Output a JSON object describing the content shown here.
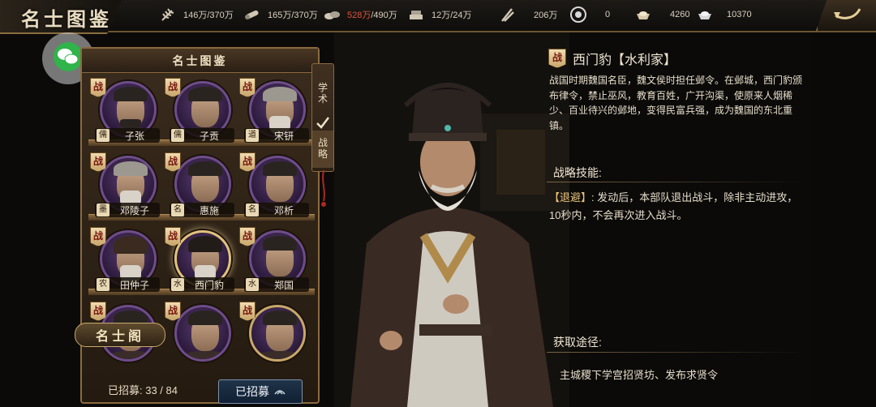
{
  "header": {
    "title": "名士图鉴",
    "resources": [
      {
        "icon": "grain-icon",
        "value": "146万/370万",
        "warn": false
      },
      {
        "icon": "wood-icon",
        "value": "165万/370万",
        "warn": false
      },
      {
        "icon": "stone-icon",
        "value": "528万",
        "extra": "/490万",
        "warn": true
      },
      {
        "icon": "iron-icon",
        "value": "12万/24万",
        "warn": false
      },
      {
        "icon": "decree-icon",
        "value": "206万",
        "warn": false
      },
      {
        "icon": "coin-icon",
        "value": "0",
        "warn": false
      },
      {
        "icon": "gold-ingot-icon",
        "value": "4260",
        "warn": false
      },
      {
        "icon": "silver-ingot-icon",
        "value": "10370",
        "warn": false
      }
    ]
  },
  "panel": {
    "title": "名士图鉴",
    "cards": [
      {
        "badge": "战",
        "school": "儒",
        "name": "子张",
        "selected": false
      },
      {
        "badge": "战",
        "school": "儒",
        "name": "子贡",
        "selected": false
      },
      {
        "badge": "战",
        "school": "道",
        "name": "宋钘",
        "selected": false
      },
      {
        "badge": "战",
        "school": "墨",
        "name": "邓陵子",
        "selected": false
      },
      {
        "badge": "战",
        "school": "名",
        "name": "惠施",
        "selected": false
      },
      {
        "badge": "战",
        "school": "名",
        "name": "邓析",
        "selected": false
      },
      {
        "badge": "战",
        "school": "农",
        "name": "田仲子",
        "selected": false
      },
      {
        "badge": "战",
        "school": "水",
        "name": "西门豹",
        "selected": true
      },
      {
        "badge": "战",
        "school": "水",
        "name": "郑国",
        "selected": false
      },
      {
        "badge": "战",
        "school": "",
        "name": "",
        "selected": false
      },
      {
        "badge": "战",
        "school": "",
        "name": "",
        "selected": false
      },
      {
        "badge": "战",
        "school": "",
        "name": "",
        "selected": false
      }
    ],
    "recruit_count": "已招募: 33 / 84",
    "recruit_filter": "已招募",
    "pavilion_button": "名士阁"
  },
  "tabs": {
    "academic": "学术",
    "strategy": "战略"
  },
  "detail": {
    "badge": "战",
    "name": "西门豹【水利家】",
    "bio": "战国时期魏国名臣，魏文侯时担任邺令。在邺城，西门豹颁布律令，禁止巫风，教育百姓，广开沟渠，使原来人烟稀少、百业待兴的邺地，变得民富兵强，成为魏国的东北重镇。",
    "skill_title": "战略技能:",
    "skill_name": "【退避】",
    "skill_desc": ": 发动后，本部队退出战斗，除非主动进攻，10秒内，不会再次进入战斗。",
    "source_title": "获取途径:",
    "source_text": "主城稷下学宫招贤坊、发布求贤令"
  }
}
